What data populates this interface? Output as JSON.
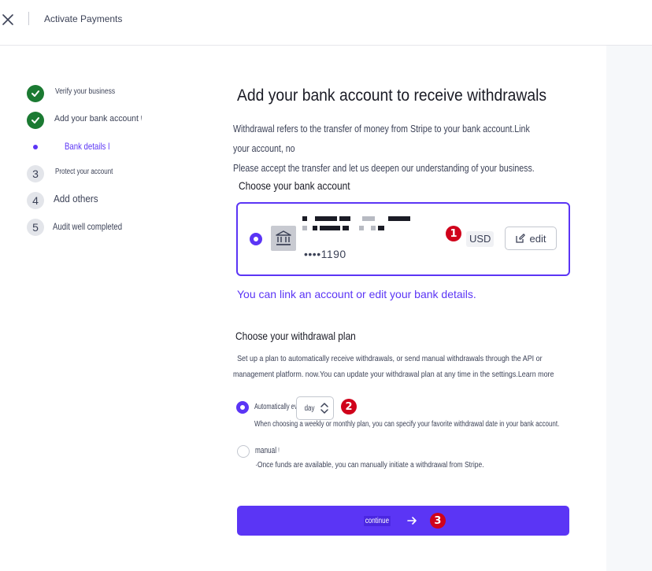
{
  "topbar": {
    "title": "Activate Payments"
  },
  "steps": [
    {
      "label": "Verify your business",
      "state": "done"
    },
    {
      "label": "Add your bank account ᵎ",
      "state": "done"
    },
    {
      "label": "Bank details ǀ",
      "state": "current"
    },
    {
      "label": "Protect your account",
      "state": "pending",
      "number": "3"
    },
    {
      "label": "Add others",
      "state": "pending",
      "number": "4"
    },
    {
      "label": "Audit well completed",
      "state": "pending",
      "number": "5"
    }
  ],
  "main": {
    "heading": "Add your bank account to receive withdrawals",
    "intro_line1": "Withdrawal refers to the transfer of money from Stripe to your bank account.Link your account, no",
    "intro_line2": "Please accept the transfer and let us deepen our understanding of your business.",
    "choose_account_title": "Choose your bank account",
    "bank": {
      "last4": "••••1190",
      "currency": "USD",
      "edit_label": "edit",
      "annotation": "1"
    },
    "link_text": "You can link an account or edit your bank details.",
    "plan_title": "Choose your withdrawal plan",
    "plan_desc": "Set up a plan to automatically receive withdrawals, or send manual withdrawals through the API or management platform. now.You can update your withdrawal plan at any time in the settings.Learn more",
    "auto_option": {
      "label": "Automatically every ⁝",
      "select_value": "day",
      "annotation": "2",
      "hint": "When choosing a weekly or monthly plan, you can specify your favorite withdrawal date in your bank account."
    },
    "manual_option": {
      "label": "manual ᵎ",
      "hint": "·Once funds are available, you can manually initiate a withdrawal from Stripe."
    },
    "continue": {
      "label": "continue",
      "annotation": "3"
    }
  },
  "colors": {
    "accent": "#5b35f5",
    "success": "#1b7a32",
    "annotation": "#d0021b"
  }
}
